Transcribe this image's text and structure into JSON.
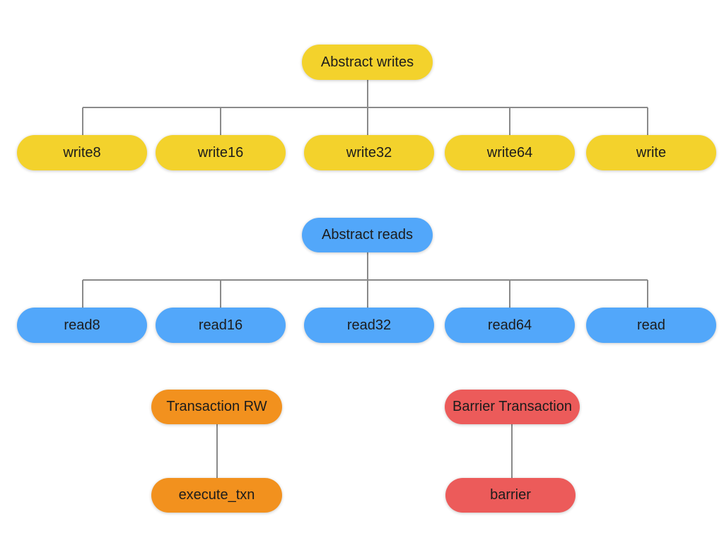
{
  "diagram": {
    "colors": {
      "writes": "#f3d22c",
      "reads": "#52a7fa",
      "transaction_rw": "#f2911e",
      "barrier": "#ec5b5a",
      "edge": "#8a8a8a"
    },
    "writes": {
      "root": "Abstract writes",
      "children": [
        "write8",
        "write16",
        "write32",
        "write64",
        "write"
      ]
    },
    "reads": {
      "root": "Abstract reads",
      "children": [
        "read8",
        "read16",
        "read32",
        "read64",
        "read"
      ]
    },
    "transaction_rw": {
      "root": "Transaction RW",
      "children": [
        "execute_txn"
      ]
    },
    "barrier_transaction": {
      "root": "Barrier Transaction",
      "children": [
        "barrier"
      ]
    }
  }
}
